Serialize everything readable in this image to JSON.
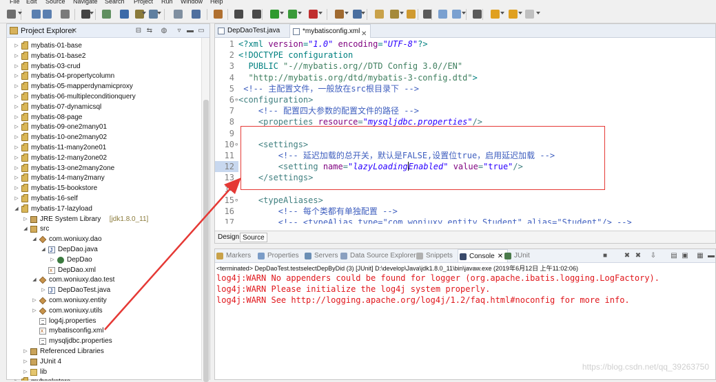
{
  "menu": [
    "File",
    "Edit",
    "Source",
    "Navigate",
    "Search",
    "Project",
    "Run",
    "Window",
    "Help"
  ],
  "explorer": {
    "title": "Project Explorer",
    "close": "✕",
    "items": [
      {
        "label": "mybatis-01-base",
        "depth": 0,
        "icon": "project-icon",
        "twist": "▷"
      },
      {
        "label": "mybatis-01-base2",
        "depth": 0,
        "icon": "project-icon",
        "twist": "▷"
      },
      {
        "label": "mybatis-03-crud",
        "depth": 0,
        "icon": "project-icon",
        "twist": "▷"
      },
      {
        "label": "mybatis-04-propertycolumn",
        "depth": 0,
        "icon": "project-icon",
        "twist": "▷"
      },
      {
        "label": "mybatis-05-mapperdynamicproxy",
        "depth": 0,
        "icon": "project-icon",
        "twist": "▷"
      },
      {
        "label": "mybatis-06-multipleconditionquery",
        "depth": 0,
        "icon": "project-icon",
        "twist": "▷"
      },
      {
        "label": "mybatis-07-dynamicsql",
        "depth": 0,
        "icon": "project-icon",
        "twist": "▷"
      },
      {
        "label": "mybatis-08-page",
        "depth": 0,
        "icon": "project-icon",
        "twist": "▷"
      },
      {
        "label": "mybatis-09-one2many01",
        "depth": 0,
        "icon": "project-icon",
        "twist": "▷"
      },
      {
        "label": "mybatis-10-one2many02",
        "depth": 0,
        "icon": "project-icon",
        "twist": "▷"
      },
      {
        "label": "mybatis-11-many2one01",
        "depth": 0,
        "icon": "project-icon",
        "twist": "▷"
      },
      {
        "label": "mybatis-12-many2one02",
        "depth": 0,
        "icon": "project-icon",
        "twist": "▷"
      },
      {
        "label": "mybatis-13-one2many2one",
        "depth": 0,
        "icon": "project-icon",
        "twist": "▷"
      },
      {
        "label": "mybatis-14-many2many",
        "depth": 0,
        "icon": "project-icon",
        "twist": "▷"
      },
      {
        "label": "mybatis-15-bookstore",
        "depth": 0,
        "icon": "project-icon",
        "twist": "▷"
      },
      {
        "label": "mybatis-16-self",
        "depth": 0,
        "icon": "project-icon",
        "twist": "▷"
      },
      {
        "label": "mybatis-17-lazyload",
        "depth": 0,
        "icon": "project-icon",
        "twist": "◢"
      },
      {
        "label": "JRE System Library",
        "deco": " [jdk1.8.0_11]",
        "depth": 1,
        "icon": "library-icon",
        "twist": "▷"
      },
      {
        "label": "src",
        "depth": 1,
        "icon": "source-folder-icon",
        "twist": "◢"
      },
      {
        "label": "com.woniuxy.dao",
        "depth": 2,
        "icon": "package-icon",
        "twist": "◢"
      },
      {
        "label": "DepDao.java",
        "depth": 3,
        "icon": "java-file-icon",
        "twist": "◢"
      },
      {
        "label": "DepDao",
        "depth": 4,
        "icon": "interface-icon",
        "twist": "▷"
      },
      {
        "label": "DepDao.xml",
        "depth": 3,
        "icon": "xml-file-icon",
        "twist": ""
      },
      {
        "label": "com.woniuxy.dao.test",
        "depth": 2,
        "icon": "package-icon",
        "twist": "◢"
      },
      {
        "label": "DepDaoTest.java",
        "depth": 3,
        "icon": "java-file-icon",
        "twist": "▷"
      },
      {
        "label": "com.woniuxy.entity",
        "depth": 2,
        "icon": "package-icon",
        "twist": "▷"
      },
      {
        "label": "com.woniuxy.utils",
        "depth": 2,
        "icon": "package-icon",
        "twist": "▷"
      },
      {
        "label": "log4j.properties",
        "depth": 2,
        "icon": "properties-file-icon",
        "twist": ""
      },
      {
        "label": "mybatisconfig.xml",
        "depth": 2,
        "icon": "xml-file-icon",
        "twist": "",
        "selected": true
      },
      {
        "label": "mysqljdbc.properties",
        "depth": 2,
        "icon": "properties-file-icon",
        "twist": ""
      },
      {
        "label": "Referenced Libraries",
        "depth": 1,
        "icon": "library-icon",
        "twist": "▷"
      },
      {
        "label": "JUnit 4",
        "depth": 1,
        "icon": "library-icon",
        "twist": "▷"
      },
      {
        "label": "lib",
        "depth": 1,
        "icon": "folder-icon",
        "twist": "▷"
      },
      {
        "label": "mybookstore",
        "depth": 0,
        "icon": "project-icon",
        "twist": "▷"
      }
    ]
  },
  "editor": {
    "tabs": [
      {
        "label": "DepDaoTest.java",
        "active": false
      },
      {
        "label": "*mybatisconfig.xml",
        "active": true
      }
    ],
    "tab_close": "✕",
    "bottom_tabs": [
      "Design",
      "Source"
    ],
    "lines": [
      {
        "n": "1",
        "fold": "",
        "parts": [
          [
            "pi",
            "<?xml "
          ],
          [
            "attr",
            "version"
          ],
          [
            "pi",
            "="
          ],
          [
            "val",
            "\"1.0\""
          ],
          [
            "pi",
            " "
          ],
          [
            "attr",
            "encoding"
          ],
          [
            "pi",
            "="
          ],
          [
            "val",
            "\"UTF-8\""
          ],
          [
            "pi",
            "?>"
          ]
        ]
      },
      {
        "n": "2",
        "fold": "",
        "parts": [
          [
            "doc",
            "<!DOCTYPE configuration"
          ]
        ]
      },
      {
        "n": "3",
        "fold": "",
        "parts": [
          [
            "doc",
            "  PUBLIC "
          ],
          [
            "str",
            "\"-//mybatis.org//DTD Config 3.0//EN\""
          ]
        ]
      },
      {
        "n": "4",
        "fold": "",
        "parts": [
          [
            "str",
            "  \"http://mybatis.org/dtd/mybatis-3-config.dtd\""
          ],
          [
            "doc",
            ">"
          ]
        ]
      },
      {
        "n": "5",
        "fold": "",
        "parts": [
          [
            "cm",
            " <!-- 主配置文件，一般放在src根目录下 -->"
          ]
        ]
      },
      {
        "n": "6",
        "fold": "⊖",
        "parts": [
          [
            "tag",
            "<configuration>"
          ]
        ]
      },
      {
        "n": "7",
        "fold": "",
        "parts": [
          [
            "cm",
            "    <!-- 配置四大参数的配置文件的路径 -->"
          ]
        ]
      },
      {
        "n": "8",
        "fold": "",
        "parts": [
          [
            "tag",
            "    <properties "
          ],
          [
            "attr",
            "resource"
          ],
          [
            "tag",
            "="
          ],
          [
            "val",
            "\"mysqljdbc.properties\""
          ],
          [
            "tag",
            "/>"
          ]
        ]
      },
      {
        "n": "9",
        "fold": "",
        "parts": []
      },
      {
        "n": "10",
        "fold": "⊖",
        "parts": [
          [
            "tag",
            "    <settings>"
          ]
        ]
      },
      {
        "n": "11",
        "fold": "",
        "parts": [
          [
            "cm",
            "        <!-- 延迟加载的总开关，默认是FALSE,设置位true，启用延迟加载 -->"
          ]
        ]
      },
      {
        "n": "12",
        "fold": "",
        "hl": true,
        "parts": [
          [
            "tag",
            "        <setting "
          ],
          [
            "attr",
            "name"
          ],
          [
            "tag",
            "="
          ],
          [
            "val",
            "\"lazyLoading"
          ],
          [
            "caret",
            ""
          ],
          [
            "val",
            "Enabled\""
          ],
          [
            "tag",
            " "
          ],
          [
            "attr",
            "value"
          ],
          [
            "tag",
            "="
          ],
          [
            "val2",
            "\"true\""
          ],
          [
            "tag",
            "/>"
          ]
        ]
      },
      {
        "n": "13",
        "fold": "",
        "parts": [
          [
            "tag",
            "    </settings>"
          ]
        ]
      },
      {
        "n": "14",
        "fold": "",
        "parts": []
      },
      {
        "n": "15",
        "fold": "⊖",
        "parts": [
          [
            "tag",
            "    <typeAliases>"
          ]
        ]
      },
      {
        "n": "16",
        "fold": "",
        "parts": [
          [
            "cm",
            "        <!-- 每个类都有单独配置 -->"
          ]
        ]
      },
      {
        "n": "17",
        "fold": "",
        "parts": [
          [
            "cm",
            "        <!-- <typeAlias type=\"com.woniuxy.entity.Student\" alias=\"Student\"/> -->"
          ]
        ]
      }
    ]
  },
  "console": {
    "tabs": [
      {
        "label": "Markers",
        "color": "#c9a24a"
      },
      {
        "label": "Properties",
        "color": "#7a9cc7"
      },
      {
        "label": "Servers",
        "color": "#6b8fb5"
      },
      {
        "label": "Data Source Explorer",
        "color": "#8aa0c0"
      },
      {
        "label": "Snippets",
        "color": "#b0b0b0"
      },
      {
        "label": "Console",
        "color": "#3a4a6a",
        "active": true
      },
      {
        "label": "JUnit",
        "color": "#4a7a4a"
      }
    ],
    "terminated": "<terminated> DepDaoTest.testselectDepByDid (3) [JUnit] D:\\develop\\Java\\jdk1.8.0_11\\bin\\javaw.exe (2019年6月12日 上午11:02:06)",
    "lines": [
      "log4j:WARN No appenders could be found for logger (org.apache.ibatis.logging.LogFactory).",
      "log4j:WARN Please initialize the log4j system properly.",
      "log4j:WARN See http://logging.apache.org/log4j/1.2/faq.html#noconfig for more info."
    ]
  },
  "watermark": "https://blog.csdn.net/qq_39263750",
  "colors": {
    "annotation": "#e53935",
    "error": "#e0161b"
  }
}
